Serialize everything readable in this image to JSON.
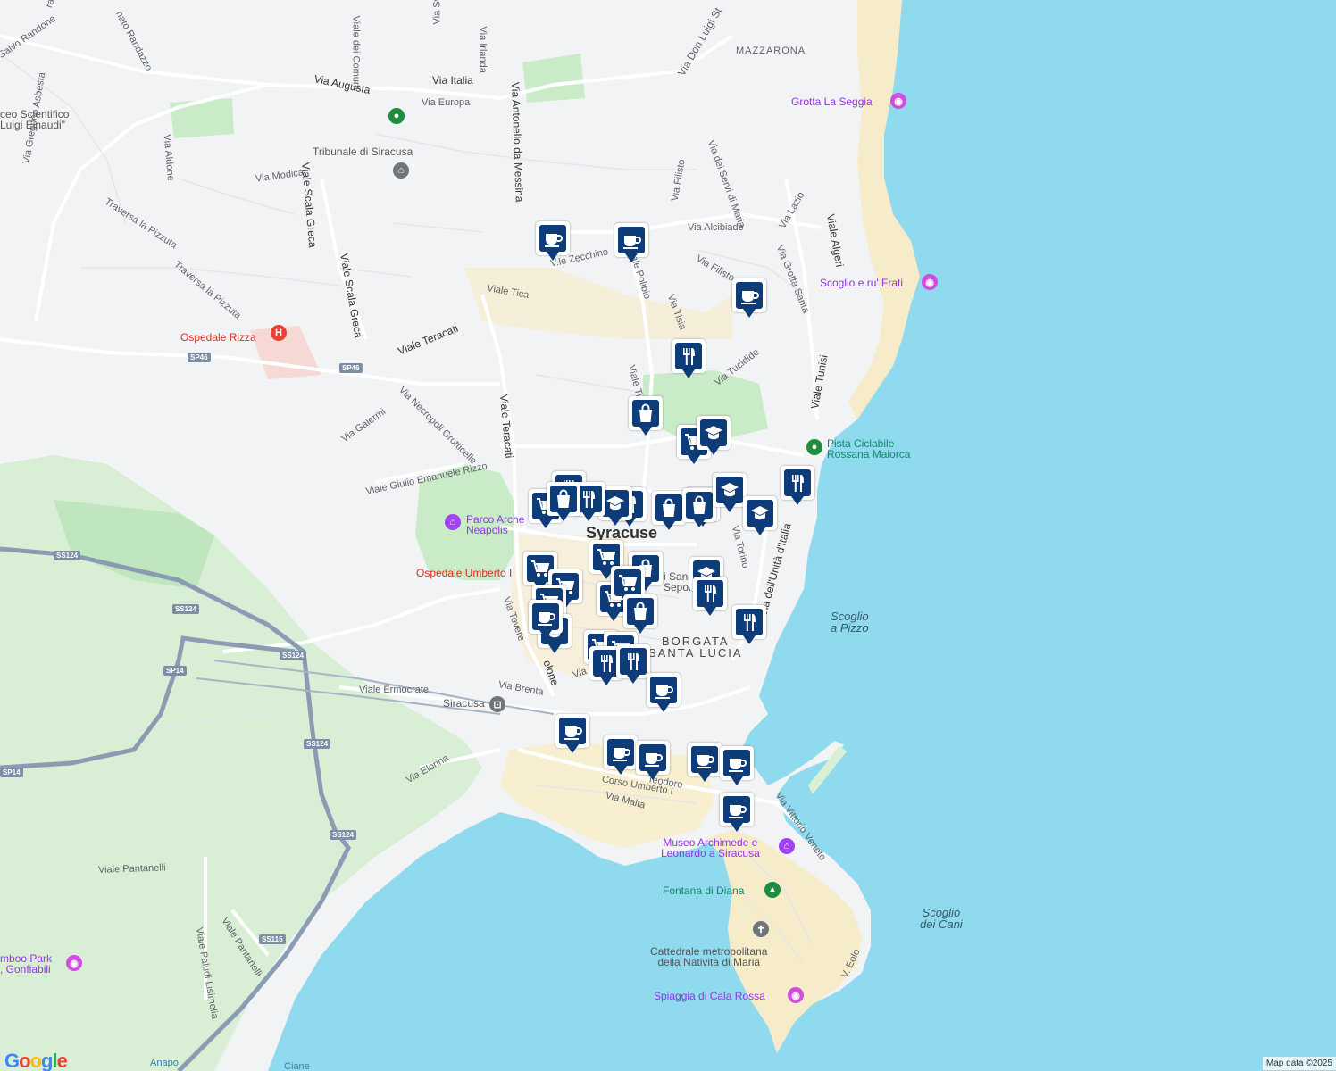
{
  "map": {
    "city_label": "Syracuse",
    "district_label": [
      "BORGATA",
      "SANTA LUCIA"
    ],
    "attribution": "Map data ©2025",
    "google_logo": [
      {
        "ch": "G",
        "color": "#4285f4"
      },
      {
        "ch": "o",
        "color": "#ea4335"
      },
      {
        "ch": "o",
        "color": "#fbbc05"
      },
      {
        "ch": "g",
        "color": "#4285f4"
      },
      {
        "ch": "l",
        "color": "#34a853"
      },
      {
        "ch": "e",
        "color": "#ea4335"
      }
    ],
    "colors": {
      "land": "#f2f3f5",
      "water": "#8fdaee",
      "park": "#cdeccd",
      "beach": "#f6ecc9",
      "road": "#ffffff",
      "highway": "#7d8fa6",
      "marker": "#0d3c78"
    }
  },
  "streets": {
    "via_calvario": "Salvo Randone",
    "via_randazzo": "nato Randazzo",
    "via_gravina": "rava",
    "viale_comuni": "Viale dei Comuni",
    "via_svizzera": "Via Svizzera",
    "via_irlanda": "Via Irlanda",
    "via_don_luigi": "Via Don Luigi St",
    "viale_augusta": "Via Augusta",
    "via_italia": "Via Italia",
    "via_europa": "Via Europa",
    "via_messina": "Via Antonello da Messina",
    "via_aldone": "Via Aldone",
    "via_asbesta": "Via Gregorio Asbesta",
    "via_modica": "Via Modica",
    "viale_scala_greca": "Viale Scala Greca",
    "viale_scala_greca_2": "Viale Scala Greca",
    "traversa_pizzuta_1": "Traversa la Pizzuta",
    "traversa_pizzuta_2": "Traversa la Pizzuta",
    "viale_zecchino": "V.le Zecchino",
    "viale_polibio": "Viale Polibio",
    "via_filisto": "Via Filisto",
    "via_filisto_2": "Via Filisto",
    "via_servi": "Via dei Servi di Maria",
    "via_alcibiade": "Via Alcibiade",
    "via_lazio": "Via Lazio",
    "via_grotta_santa": "Via Grotta Santa",
    "viale_algeri": "Viale Algeri",
    "viale_tica": "Viale Tica",
    "via_tisia": "Via Tisia",
    "viale_teracati": "Viale Teracati",
    "viale_teracati_2": "Viale Teracati",
    "via_necropoli": "Via Necropoli Grotticelle",
    "via_galermi": "Via Galermi",
    "viale_rizzo": "Viale Giulio Emanuele Rizzo",
    "viale_tica_2": "Viale Tic",
    "via_tucidide": "Via Tucidide",
    "viale_tunisi": "Viale Tunisi",
    "via_torino": "Via Torino",
    "via_unita": "Via dell'Unità d'Italia",
    "via_tevere": "Via Tevere",
    "via_ermocrate": "Viale Ermocrate",
    "via_brenta": "Via Brenta",
    "via_elorina": "Via Elorina",
    "corso_umberto": "Corso Umberto I",
    "via_malta": "Via Malta",
    "via_teodoro": "Teodoro",
    "via_vittorio_veneto": "Via Vittorio Veneto",
    "viale_pantanelli": "Viale Pantanelli",
    "viale_pantanelli_2": "Viale Pantanelli",
    "via_paludi": "Viale Paludi Lisimelia",
    "via_eolo": "V. Eolo",
    "gelone": "elone",
    "via_short": "Via"
  },
  "routes": [
    "SP46",
    "SP46",
    "SS124",
    "SS124",
    "SS124",
    "SS124",
    "SS124",
    "SP14",
    "SP14",
    "SS115"
  ],
  "water_labels": {
    "scoglio_pizzo": [
      "Scoglio",
      "a Pizzo"
    ],
    "scoglio_cani": [
      "Scoglio",
      "dei Cani"
    ],
    "anapo": "Anapo",
    "ciane": "Ciane",
    "mazzarona": "MAZZARONA"
  },
  "pois": {
    "liceo": [
      "ceo Scientifico",
      "Luigi Einaudi\""
    ],
    "tribunale": "Tribunale di Siracusa",
    "grotta_seggia": "Grotta La Seggia",
    "scoglio_frati": "Scoglio e ru' Frati",
    "ospedale_rizza": "Ospedale Rizza",
    "pista_ciclabile": [
      "Pista Ciclabile",
      "Rossana Maiorca"
    ],
    "parco_archeologico": [
      "Parco Arche",
      "Neapolis"
    ],
    "ospedale_umberto": "Ospedale Umberto I",
    "siracusa_station": "Siracusa",
    "museo_archimede": [
      "Museo Archimede e",
      "Leonardo a Siracusa"
    ],
    "fontana_diana": "Fontana di Diana",
    "cattedrale": [
      "Cattedrale metropolitana",
      "della Natività di Maria"
    ],
    "spiaggia_cala_rossa": "Spiaggia di Cala Rossa",
    "jamboo": [
      "mboo Park",
      ", Gonfiabili"
    ],
    "santo_sepolcro": [
      "i San",
      "Sepolc"
    ]
  },
  "poi_icons": {
    "museum": "bank-icon",
    "hospital": "hospital-icon",
    "photo": "camera-icon",
    "park": "tree-icon",
    "church": "cross-icon",
    "place": "place-icon",
    "train": "train-icon"
  },
  "markers": [
    {
      "type": "cafe"
    },
    {
      "type": "cafe"
    },
    {
      "type": "cafe"
    },
    {
      "type": "restaurant"
    },
    {
      "type": "shopping"
    },
    {
      "type": "grocery"
    },
    {
      "type": "school"
    },
    {
      "type": "restaurant"
    },
    {
      "type": "restaurant"
    },
    {
      "type": "shopping"
    },
    {
      "type": "grocery"
    },
    {
      "type": "school"
    },
    {
      "type": "restaurant"
    },
    {
      "type": "restaurant"
    },
    {
      "type": "shopping"
    },
    {
      "type": "shopping"
    },
    {
      "type": "school"
    },
    {
      "type": "school"
    },
    {
      "type": "grocery"
    },
    {
      "type": "grocery"
    },
    {
      "type": "shopping"
    },
    {
      "type": "school"
    },
    {
      "type": "restaurant"
    },
    {
      "type": "grocery"
    },
    {
      "type": "grocery"
    },
    {
      "type": "grocery"
    },
    {
      "type": "grocery"
    },
    {
      "type": "shopping"
    },
    {
      "type": "restaurant"
    },
    {
      "type": "school"
    },
    {
      "type": "grocery"
    },
    {
      "type": "grocery"
    },
    {
      "type": "restaurant"
    },
    {
      "type": "restaurant"
    },
    {
      "type": "cafe"
    },
    {
      "type": "cafe"
    },
    {
      "type": "cafe"
    },
    {
      "type": "cafe"
    },
    {
      "type": "cafe"
    },
    {
      "type": "cafe"
    },
    {
      "type": "cafe"
    },
    {
      "type": "cafe"
    },
    {
      "type": "shopping"
    }
  ]
}
